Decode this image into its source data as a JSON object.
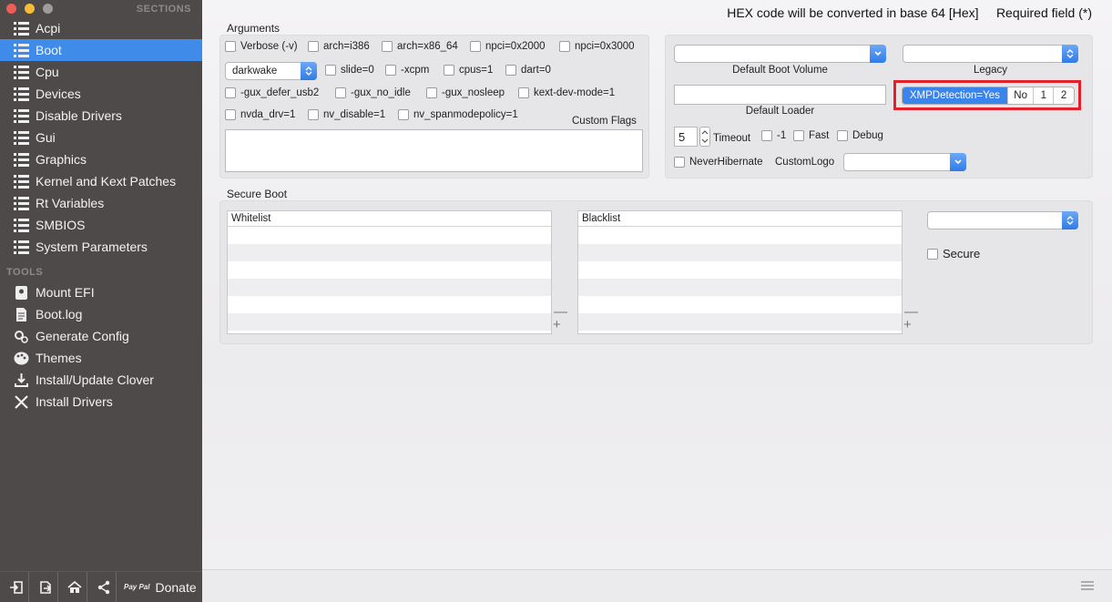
{
  "sidebar": {
    "sections_title": "SECTIONS",
    "tools_title": "TOOLS",
    "sections": [
      {
        "label": "Acpi",
        "icon": "list-icon"
      },
      {
        "label": "Boot",
        "icon": "list-icon",
        "active": true
      },
      {
        "label": "Cpu",
        "icon": "list-icon"
      },
      {
        "label": "Devices",
        "icon": "list-icon"
      },
      {
        "label": "Disable Drivers",
        "icon": "list-icon"
      },
      {
        "label": "Gui",
        "icon": "list-icon"
      },
      {
        "label": "Graphics",
        "icon": "list-icon"
      },
      {
        "label": "Kernel and Kext Patches",
        "icon": "list-icon"
      },
      {
        "label": "Rt Variables",
        "icon": "list-icon"
      },
      {
        "label": "SMBIOS",
        "icon": "list-icon"
      },
      {
        "label": "System Parameters",
        "icon": "list-icon"
      }
    ],
    "tools": [
      {
        "label": "Mount EFI",
        "icon": "disk-icon"
      },
      {
        "label": "Boot.log",
        "icon": "document-icon"
      },
      {
        "label": "Generate Config",
        "icon": "gears-icon"
      },
      {
        "label": "Themes",
        "icon": "palette-icon"
      },
      {
        "label": "Install/Update Clover",
        "icon": "download-icon"
      },
      {
        "label": "Install Drivers",
        "icon": "tools-icon"
      }
    ],
    "bottom": {
      "paypal": "Pay Pal",
      "donate": "Donate"
    }
  },
  "header": {
    "hex_note": "HEX code will be converted in base 64 [Hex]     Required field (*)"
  },
  "arguments": {
    "title": "Arguments",
    "verbose": "Verbose (-v)",
    "arch_i386": "arch=i386",
    "arch_x86_64": "arch=x86_64",
    "npci_2000": "npci=0x2000",
    "npci_3000": "npci=0x3000",
    "darkwake_value": "darkwake",
    "slide": "slide=0",
    "xcpm": "-xcpm",
    "cpus": "cpus=1",
    "dart": "dart=0",
    "gux_defer_usb2": "-gux_defer_usb2",
    "gux_no_idle": "-gux_no_idle",
    "gux_nosleep": "-gux_nosleep",
    "kext_dev_mode": "kext-dev-mode=1",
    "nvda_drv": "nvda_drv=1",
    "nv_disable": "nv_disable=1",
    "nv_spanmodepolicy": "nv_spanmodepolicy=1",
    "custom_flags_label": "Custom Flags",
    "custom_flags_value": ""
  },
  "boot_options": {
    "default_boot_volume_label": "Default Boot Volume",
    "default_boot_volume_value": "",
    "legacy_label": "Legacy",
    "legacy_value": "",
    "default_loader_label": "Default Loader",
    "default_loader_value": "",
    "xmp_options": [
      "XMPDetection=Yes",
      "No",
      "1",
      "2"
    ],
    "xmp_selected": "XMPDetection=Yes",
    "timeout_value": "5",
    "timeout_label": "Timeout",
    "minus_one": "-1",
    "fast": "Fast",
    "debug": "Debug",
    "never_hibernate": "NeverHibernate",
    "custom_logo_label": "CustomLogo",
    "custom_logo_value": ""
  },
  "secure_boot": {
    "title": "Secure Boot",
    "whitelist_header": "Whitelist",
    "blacklist_header": "Blacklist",
    "policy_value": "",
    "secure_label": "Secure"
  }
}
